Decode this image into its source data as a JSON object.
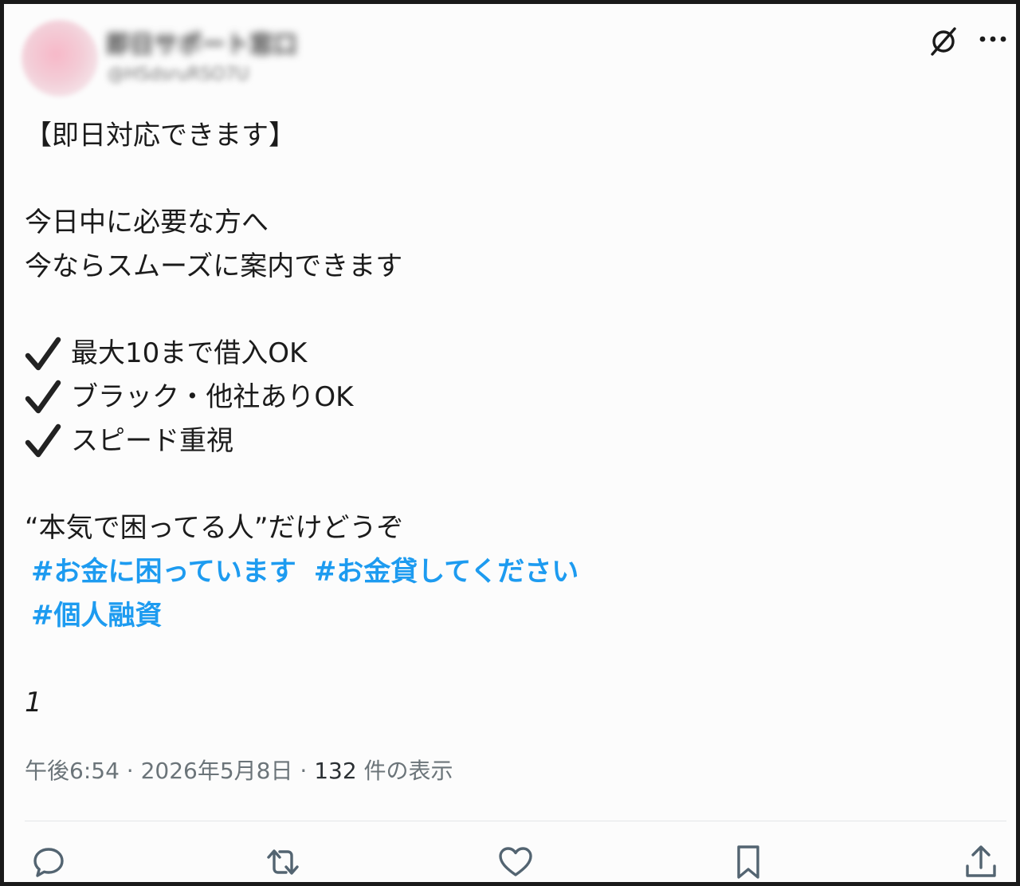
{
  "post": {
    "author": {
      "display_name": "即日サポート窓口",
      "handle": "@HSdsruRSO7U"
    },
    "title_line": "【即日対応できます】",
    "intro_lines": [
      "今日中に必要な方へ",
      "今ならスムーズに案内できます"
    ],
    "checklist": [
      "最大10まで借入OK",
      "ブラック・他社ありOK",
      "スピード重視"
    ],
    "closing_line": "“本気で困ってる人”だけどうぞ",
    "hashtags_row1": [
      "#お金に困っています",
      "#お金貸してください"
    ],
    "hashtags_row2": [
      "#個人融資"
    ],
    "count_line": "1"
  },
  "meta": {
    "time": "午後6:54",
    "separator": " · ",
    "date": "2026年5月8日",
    "views_count": "132",
    "views_label": " 件の表示"
  },
  "icons": {
    "grok": "grok-icon",
    "more": "more-icon",
    "reply": "reply-icon",
    "repost": "repost-icon",
    "like": "like-icon",
    "bookmark": "bookmark-icon",
    "share": "share-icon",
    "check": "check-icon"
  },
  "colors": {
    "hashtag": "#1d9bf0",
    "meta": "#6b7479",
    "icon": "#536471"
  }
}
